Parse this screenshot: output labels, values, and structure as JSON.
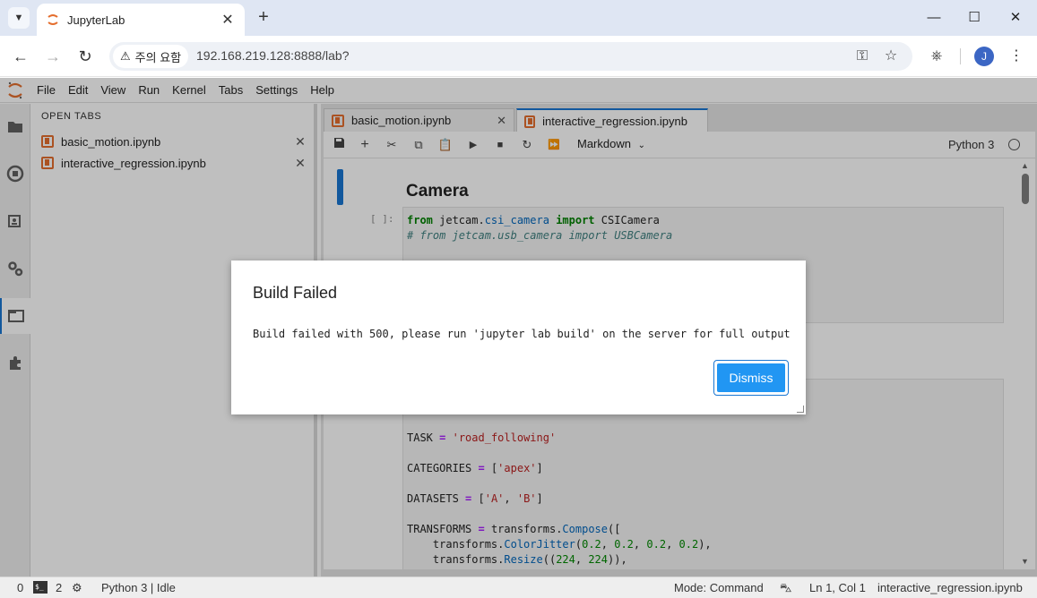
{
  "browser": {
    "tab_title": "JupyterLab",
    "security_label": "주의 요함",
    "url": "192.168.219.128:8888/lab?",
    "profile_initial": "J"
  },
  "menubar": {
    "items": [
      "File",
      "Edit",
      "View",
      "Run",
      "Kernel",
      "Tabs",
      "Settings",
      "Help"
    ]
  },
  "sidepanel": {
    "title": "OPEN TABS",
    "tabs": [
      "basic_motion.ipynb",
      "interactive_regression.ipynb"
    ]
  },
  "main": {
    "tabs": [
      "basic_motion.ipynb",
      "interactive_regression.ipynb"
    ],
    "cell_type": "Markdown",
    "kernel_name": "Python 3",
    "heading": "Camera",
    "prompt": "[ ]:"
  },
  "dialog": {
    "title": "Build Failed",
    "body": "Build failed with 500, please run 'jupyter lab build' on the server for full output",
    "dismiss_label": "Dismiss"
  },
  "statusbar": {
    "terminals": "0",
    "kernels": "2",
    "kernel_status": "Python 3 | Idle",
    "mode": "Mode: Command",
    "cursor": "Ln 1, Col 1",
    "filename": "interactive_regression.ipynb"
  },
  "colors": {
    "accent": "#1976d2",
    "button": "#2196f3",
    "jupyter_orange": "#e46e2e"
  }
}
